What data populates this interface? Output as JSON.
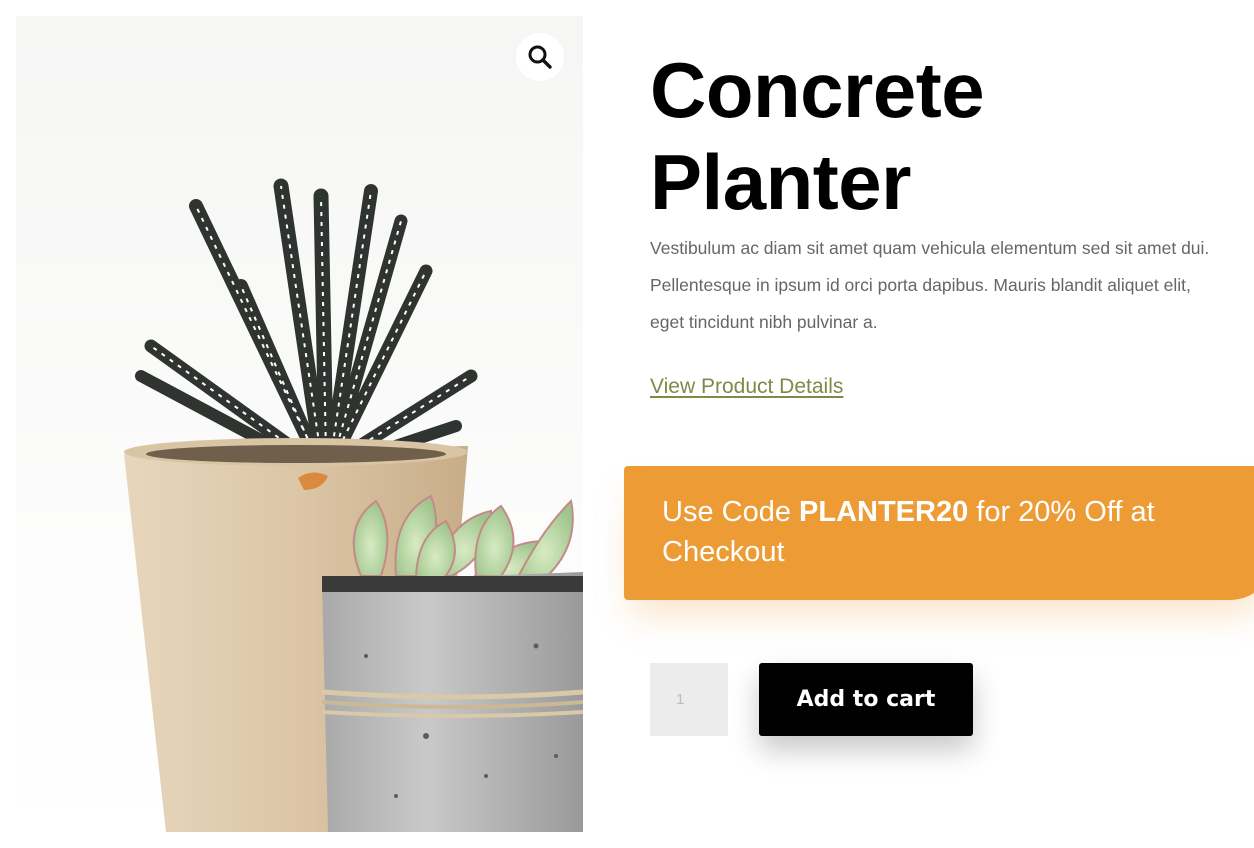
{
  "product": {
    "title_line1": "Concrete",
    "title_line2": "Planter",
    "description": "Vestibulum ac diam sit amet quam vehicula elementum sed sit amet dui. Pellentesque in ipsum id orci porta dapibus. Mauris blandit aliquet elit, eget tincidunt nibh pulvinar a.",
    "details_link": "View Product Details",
    "image_icon": "magnifier-zoom-icon"
  },
  "promo": {
    "prefix": "Use Code ",
    "code": "PLANTER20",
    "suffix": " for 20% Off at Checkout"
  },
  "cart": {
    "quantity": "1",
    "add_to_cart_label": "Add to cart"
  },
  "colors": {
    "promo_background": "#ed9b35",
    "link": "#7c8c47",
    "button_background": "#000000",
    "quantity_background": "#ececec"
  }
}
